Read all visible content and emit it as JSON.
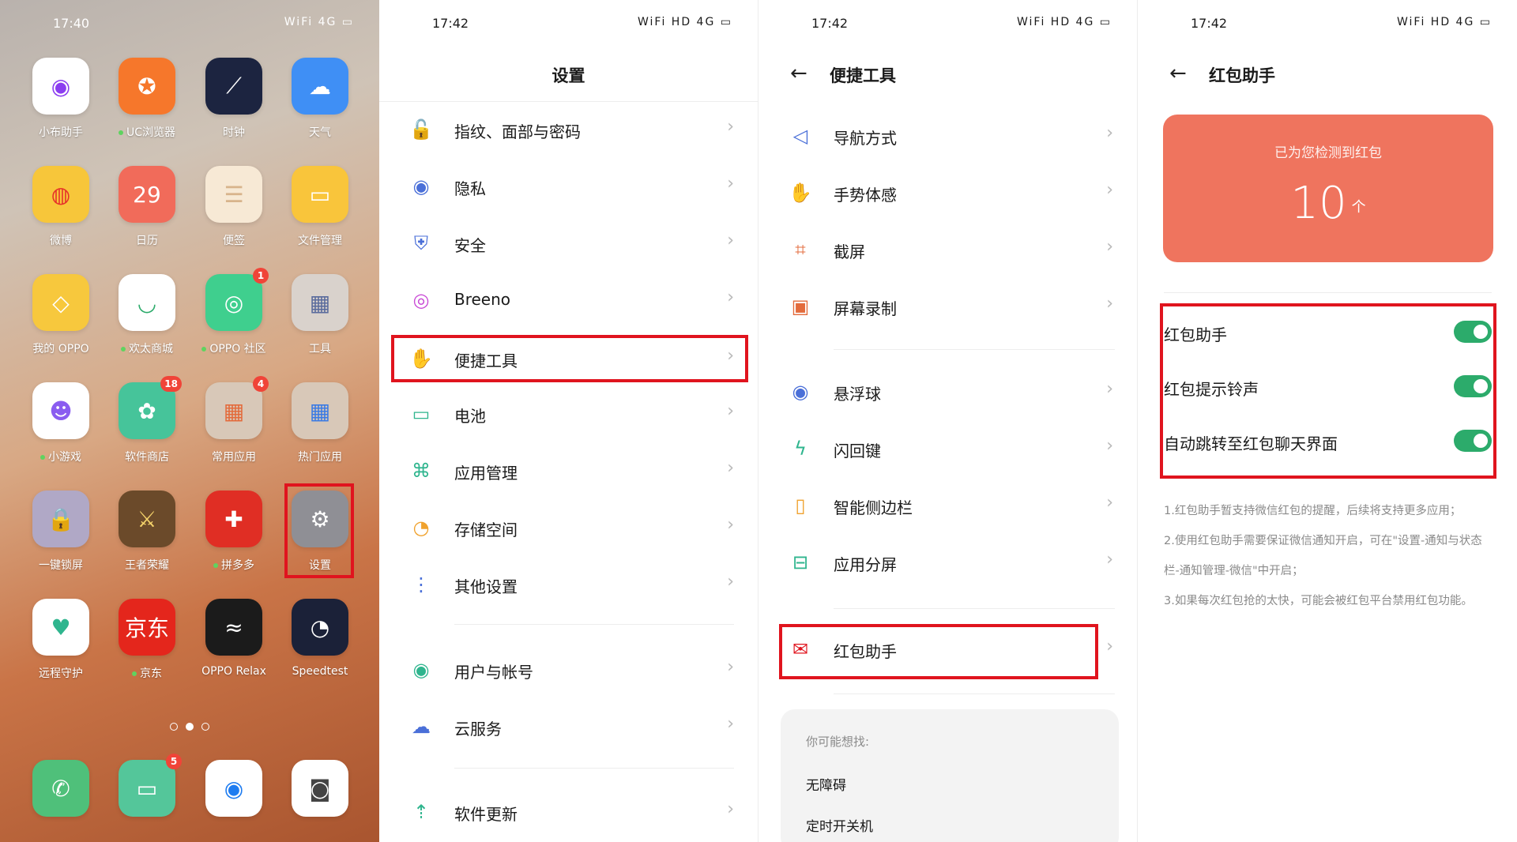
{
  "screen1": {
    "time": "17:40",
    "status_icons": "WiFi 4G ▭",
    "apps": [
      {
        "label": "小布助手",
        "icon": "breeno-icon",
        "bg": "#ffffff",
        "glyph": "◉",
        "fg": "#8b3df0",
        "dot": false,
        "badge": ""
      },
      {
        "label": "UC浏览器",
        "icon": "uc-browser-icon",
        "bg": "#f6772b",
        "glyph": "✪",
        "fg": "#ffffff",
        "dot": true,
        "badge": ""
      },
      {
        "label": "时钟",
        "icon": "clock-icon",
        "bg": "#1c2440",
        "glyph": "⟋",
        "fg": "#ffffff",
        "dot": false,
        "badge": ""
      },
      {
        "label": "天气",
        "icon": "weather-icon",
        "bg": "#3f8ff5",
        "glyph": "☁",
        "fg": "#ffffff",
        "dot": false,
        "badge": ""
      },
      {
        "label": "微博",
        "icon": "weibo-icon",
        "bg": "#f7c63a",
        "glyph": "◍",
        "fg": "#e6312a",
        "dot": false,
        "badge": ""
      },
      {
        "label": "日历",
        "icon": "calendar-icon",
        "bg": "#f16b5a",
        "glyph": "29",
        "fg": "#ffffff",
        "dot": false,
        "badge": ""
      },
      {
        "label": "便签",
        "icon": "notes-icon",
        "bg": "#f7e9d5",
        "glyph": "☰",
        "fg": "#d8b48c",
        "dot": false,
        "badge": ""
      },
      {
        "label": "文件管理",
        "icon": "folder-icon",
        "bg": "#f9c53b",
        "glyph": "▭",
        "fg": "#ffffff",
        "dot": false,
        "badge": ""
      },
      {
        "label": "我的 OPPO",
        "icon": "my-oppo-icon",
        "bg": "#f7c83d",
        "glyph": "◇",
        "fg": "#ffffff",
        "dot": false,
        "badge": ""
      },
      {
        "label": "欢太商城",
        "icon": "store-mall-icon",
        "bg": "#ffffff",
        "glyph": "◡",
        "fg": "#2cab6b",
        "dot": true,
        "badge": ""
      },
      {
        "label": "OPPO 社区",
        "icon": "community-icon",
        "bg": "#3fcf8e",
        "glyph": "◎",
        "fg": "#ffffff",
        "dot": true,
        "badge": "1"
      },
      {
        "label": "工具",
        "icon": "tools-folder-icon",
        "bg": "#d9d2cc",
        "glyph": "▦",
        "fg": "#5a6b9c",
        "dot": false,
        "badge": ""
      },
      {
        "label": "小游戏",
        "icon": "mini-games-icon",
        "bg": "#ffffff",
        "glyph": "☻",
        "fg": "#8a5cf0",
        "dot": true,
        "badge": ""
      },
      {
        "label": "软件商店",
        "icon": "app-store-icon",
        "bg": "#46c49a",
        "glyph": "✿",
        "fg": "#ffffff",
        "dot": false,
        "badge": "18"
      },
      {
        "label": "常用应用",
        "icon": "common-apps-folder-icon",
        "bg": "#d8c8b8",
        "glyph": "▦",
        "fg": "#e36b3c",
        "dot": false,
        "badge": "4"
      },
      {
        "label": "热门应用",
        "icon": "hot-apps-folder-icon",
        "bg": "#d8c8b8",
        "glyph": "▦",
        "fg": "#3c7be3",
        "dot": false,
        "badge": ""
      },
      {
        "label": "一键锁屏",
        "icon": "lock-screen-icon",
        "bg": "#b0a8c6",
        "glyph": "🔒",
        "fg": "#ffffff",
        "dot": false,
        "badge": ""
      },
      {
        "label": "王者荣耀",
        "icon": "honor-of-kings-icon",
        "bg": "#6b4a2a",
        "glyph": "⚔",
        "fg": "#f5d36b",
        "dot": false,
        "badge": ""
      },
      {
        "label": "拼多多",
        "icon": "pinduoduo-icon",
        "bg": "#e02e24",
        "glyph": "✚",
        "fg": "#ffffff",
        "dot": true,
        "badge": ""
      },
      {
        "label": "设置",
        "icon": "settings-gear-icon",
        "bg": "#8f8f95",
        "glyph": "⚙",
        "fg": "#ffffff",
        "dot": false,
        "badge": ""
      },
      {
        "label": "远程守护",
        "icon": "remote-guard-icon",
        "bg": "#ffffff",
        "glyph": "♥",
        "fg": "#2fb58e",
        "dot": false,
        "badge": ""
      },
      {
        "label": "京东",
        "icon": "jd-icon",
        "bg": "#e4261c",
        "glyph": "京东",
        "fg": "#ffffff",
        "dot": true,
        "badge": ""
      },
      {
        "label": "OPPO Relax",
        "icon": "oppo-relax-icon",
        "bg": "#1b1b1b",
        "glyph": "≈",
        "fg": "#ffffff",
        "dot": false,
        "badge": ""
      },
      {
        "label": "Speedtest",
        "icon": "speedtest-icon",
        "bg": "#1b2138",
        "glyph": "◔",
        "fg": "#ffffff",
        "dot": false,
        "badge": ""
      }
    ],
    "dock": [
      {
        "icon": "phone-icon",
        "bg": "#4fc07a",
        "glyph": "✆",
        "fg": "#ffffff",
        "badge": ""
      },
      {
        "icon": "messages-icon",
        "bg": "#54c69a",
        "glyph": "▭",
        "fg": "#ffffff",
        "badge": "5"
      },
      {
        "icon": "browser-icon",
        "bg": "#ffffff",
        "glyph": "◉",
        "fg": "#1e7cf0",
        "badge": ""
      },
      {
        "icon": "camera-icon",
        "bg": "#ffffff",
        "glyph": "◙",
        "fg": "#444444",
        "badge": ""
      }
    ],
    "page_count": 3,
    "active_page": 2
  },
  "screen2": {
    "time": "17:42",
    "status_icons": "WiFi HD 4G ▭",
    "title": "设置",
    "items": [
      {
        "label": "指纹、面部与密码",
        "icon": "lock-icon",
        "glyph": "🔓",
        "color": "#4a6fd8"
      },
      {
        "label": "隐私",
        "icon": "privacy-eye-icon",
        "glyph": "◉",
        "color": "#4a6fd8"
      },
      {
        "label": "安全",
        "icon": "shield-icon",
        "glyph": "⛨",
        "color": "#4a6fd8"
      },
      {
        "label": "Breeno",
        "icon": "breeno-icon",
        "glyph": "◎",
        "color": "#c94bd6"
      },
      {
        "label": "便捷工具",
        "icon": "convenience-tools-icon",
        "glyph": "✋",
        "color": "#f0a22e"
      },
      {
        "label": "电池",
        "icon": "battery-icon",
        "glyph": "▭",
        "color": "#2fb58e"
      },
      {
        "label": "应用管理",
        "icon": "app-management-icon",
        "glyph": "⌘",
        "color": "#2fb58e"
      },
      {
        "label": "存储空间",
        "icon": "storage-icon",
        "glyph": "◔",
        "color": "#f0a22e"
      },
      {
        "label": "其他设置",
        "icon": "more-settings-icon",
        "glyph": "⋮",
        "color": "#4a6fd8"
      },
      {
        "label": "用户与帐号",
        "icon": "user-account-icon",
        "glyph": "◉",
        "color": "#2fb58e"
      },
      {
        "label": "云服务",
        "icon": "cloud-icon",
        "glyph": "☁",
        "color": "#4a6fd8"
      },
      {
        "label": "软件更新",
        "icon": "update-arrow-icon",
        "glyph": "⇡",
        "color": "#2fb58e"
      }
    ]
  },
  "screen3": {
    "time": "17:42",
    "status_icons": "WiFi HD 4G ▭",
    "title": "便捷工具",
    "items": [
      {
        "label": "导航方式",
        "icon": "navigation-icon",
        "glyph": "◁",
        "color": "#4a6fd8"
      },
      {
        "label": "手势体感",
        "icon": "gesture-hand-icon",
        "glyph": "✋",
        "color": "#2fb58e"
      },
      {
        "label": "截屏",
        "icon": "screenshot-crop-icon",
        "glyph": "⌗",
        "color": "#e36b3c"
      },
      {
        "label": "屏幕录制",
        "icon": "screen-record-icon",
        "glyph": "▣",
        "color": "#e36b3c"
      },
      {
        "label": "悬浮球",
        "icon": "floating-ball-icon",
        "glyph": "◉",
        "color": "#4a6fd8"
      },
      {
        "label": "闪回键",
        "icon": "flashback-icon",
        "glyph": "ϟ",
        "color": "#2fb58e"
      },
      {
        "label": "智能侧边栏",
        "icon": "smart-sidebar-icon",
        "glyph": "▯",
        "color": "#f0a22e"
      },
      {
        "label": "应用分屏",
        "icon": "split-screen-icon",
        "glyph": "⊟",
        "color": "#2fb58e"
      },
      {
        "label": "红包助手",
        "icon": "red-packet-icon",
        "glyph": "✉",
        "color": "#e0141e"
      }
    ],
    "suggest_title": "你可能想找:",
    "suggest_items": [
      "无障碍",
      "定时开关机"
    ]
  },
  "screen4": {
    "time": "17:42",
    "status_icons": "WiFi HD 4G ▭",
    "title": "红包助手",
    "card_title": "已为您检测到红包",
    "card_count": "10",
    "card_unit": "个",
    "card_color": "#ef745e",
    "toggles": [
      {
        "label": "红包助手",
        "on": true
      },
      {
        "label": "红包提示铃声",
        "on": true
      },
      {
        "label": "自动跳转至红包聊天界面",
        "on": true
      }
    ],
    "notes": [
      "1.红包助手暂支持微信红包的提醒，后续将支持更多应用；",
      "2.使用红包助手需要保证微信通知开启，可在\"设置-通知与状态栏-通知管理-微信\"中开启；",
      "3.如果每次红包抢的太快，可能会被红包平台禁用红包功能。"
    ]
  },
  "colors": {
    "highlight": "#e0141e",
    "switch_on": "#2cab6b",
    "chevron": "#b8b8b8"
  },
  "chevron_glyph": "›",
  "back_glyph": "←"
}
